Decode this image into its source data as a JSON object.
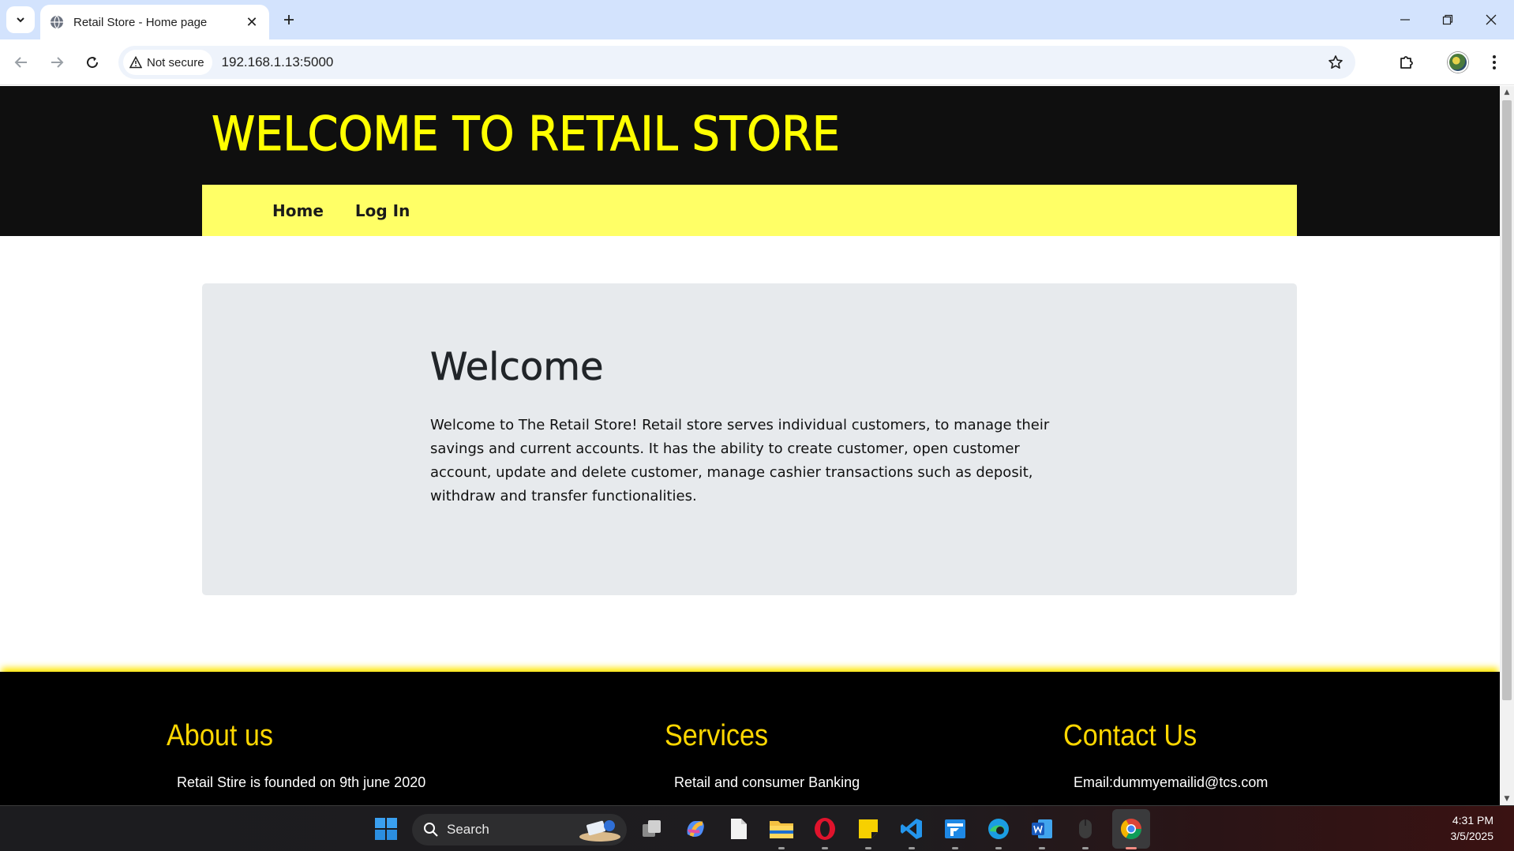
{
  "browser": {
    "tab_title": "Retail Store - Home page",
    "security_label": "Not secure",
    "url": "192.168.1.13:5000"
  },
  "site": {
    "title": "WELCOME TO RETAIL STORE",
    "nav": [
      "Home",
      "Log In"
    ],
    "welcome_heading": "Welcome",
    "welcome_text": "Welcome to The Retail Store! Retail store serves individual customers, to manage their savings and current accounts. It has the ability to create customer, open customer account, update and delete customer, manage cashier transactions such as deposit, withdraw and transfer functionalities."
  },
  "footer": {
    "about": {
      "heading": "About us",
      "text": "Retail Stire is founded on 9th june 2020"
    },
    "services": {
      "heading": "Services",
      "text": "Retail and consumer Banking"
    },
    "contact": {
      "heading": "Contact Us",
      "text": "Email:dummyemailid@tcs.com"
    }
  },
  "taskbar": {
    "search_label": "Search",
    "time": "4:31 PM",
    "date": "3/5/2025"
  },
  "colors": {
    "header_bg": "#0f0f0f",
    "title_yellow": "#ffff00",
    "nav_yellow": "#ffff66",
    "jumbotron_bg": "#e7eaed",
    "footer_heading": "#ffd700"
  }
}
